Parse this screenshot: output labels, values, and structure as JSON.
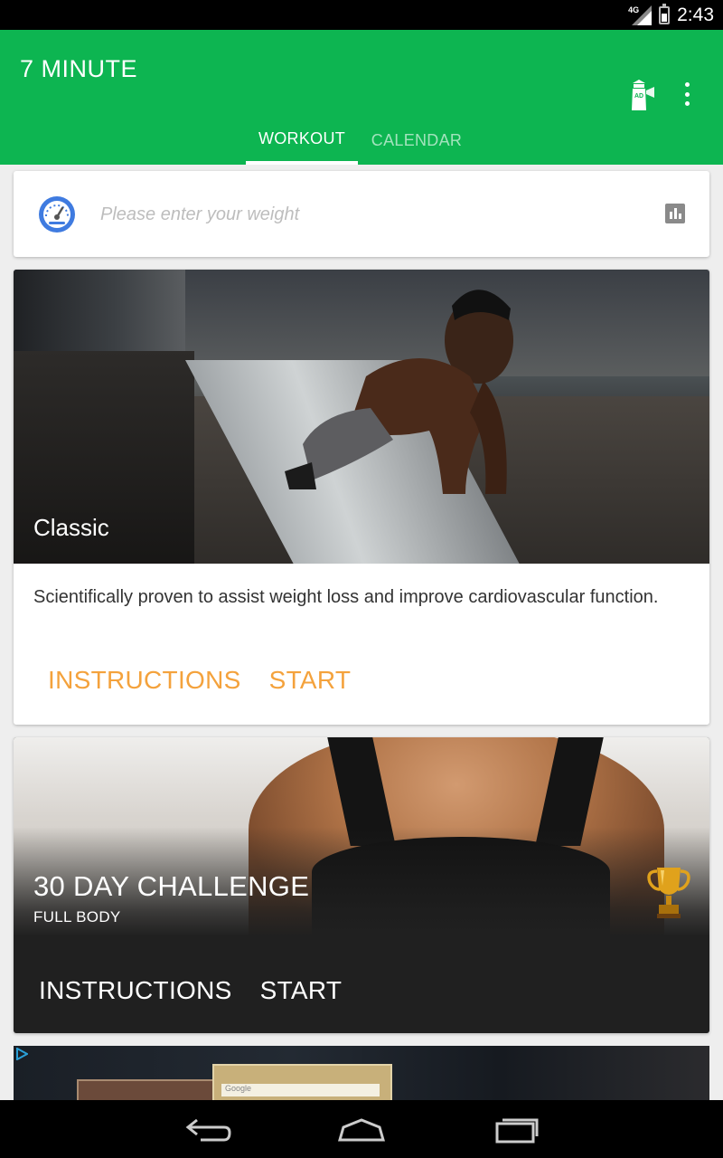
{
  "status_bar": {
    "time": "2:43",
    "network": "4G",
    "icons": [
      "signal-icon",
      "battery-icon"
    ]
  },
  "app_bar": {
    "title": "7 MINUTE",
    "icons": [
      "ad-lighthouse-icon",
      "overflow-menu-icon"
    ],
    "background": "#0db551"
  },
  "tabs": [
    {
      "label": "WORKOUT",
      "active": true
    },
    {
      "label": "CALENDAR",
      "active": false
    }
  ],
  "weight": {
    "placeholder": "Please enter your weight",
    "value": ""
  },
  "classic": {
    "title": "Classic",
    "description": "Scientifically proven to assist weight loss and improve cardiovascular function.",
    "instructions_label": "INSTRUCTIONS",
    "start_label": "START",
    "accent": "#f4a23c"
  },
  "challenge": {
    "title": "30 DAY CHALLENGE",
    "subtitle": "FULL BODY",
    "instructions_label": "INSTRUCTIONS",
    "start_label": "START"
  },
  "ad": {
    "search_text": "Google"
  },
  "nav_bar": {
    "icons": [
      "back-icon",
      "home-icon",
      "recents-icon"
    ]
  }
}
